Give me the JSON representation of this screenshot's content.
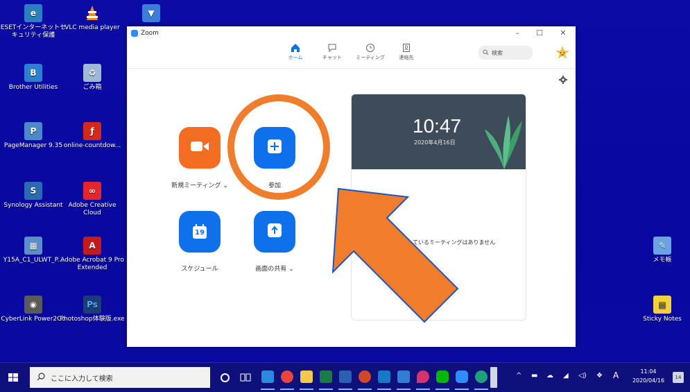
{
  "desktop": {
    "icons": [
      {
        "label": "ESETインターネットセキュリティ保護",
        "icon": "eset-icon",
        "color": "#2a7fbf"
      },
      {
        "label": "VLC media player",
        "icon": "vlc-cone-icon",
        "color": "#f08a24"
      },
      {
        "label": "",
        "icon": "installer-icon",
        "color": "#3b7dd8"
      },
      {
        "label": "Brother Utilities",
        "icon": "brother-icon",
        "color": "#2d7fd0"
      },
      {
        "label": "ごみ箱",
        "icon": "recycle-bin-icon",
        "color": "#9fb8d8"
      },
      {
        "label": "PageManager 9.35",
        "icon": "pagemanager-icon",
        "color": "#4a88c8"
      },
      {
        "label": "online-countdow...",
        "icon": "flash-icon",
        "color": "#d6271b"
      },
      {
        "label": "Synology Assistant",
        "icon": "synology-icon",
        "color": "#2a6bb0"
      },
      {
        "label": "Adobe Creative Cloud",
        "icon": "creative-cloud-icon",
        "color": "#e4262b"
      },
      {
        "label": "Y15A_C1_ULWT_P...",
        "icon": "document-icon",
        "color": "#5a8ec9"
      },
      {
        "label": "Adobe Acrobat 9 Pro Extended",
        "icon": "acrobat-icon",
        "color": "#c61a1a"
      },
      {
        "label": "CyberLink Power2Go",
        "icon": "power2go-icon",
        "color": "#5a5a5a"
      },
      {
        "label": "Photoshop体験版.exe",
        "icon": "photoshop-icon",
        "color": "#1c3c78"
      },
      {
        "label": "メモ帳",
        "icon": "notepad-icon",
        "color": "#6aa3e0"
      },
      {
        "label": "Sticky Notes",
        "icon": "sticky-notes-icon",
        "color": "#f4d13b"
      }
    ]
  },
  "zoom": {
    "title": "Zoom",
    "window_controls": {
      "minimize": "–",
      "maximize": "☐",
      "close": "✕"
    },
    "tabs": [
      {
        "label": "ホーム",
        "icon": "home-icon",
        "active": true
      },
      {
        "label": "チャット",
        "icon": "chat-icon",
        "active": false
      },
      {
        "label": "ミーティング",
        "icon": "clock-icon",
        "active": false
      },
      {
        "label": "連絡先",
        "icon": "contacts-icon",
        "active": false
      }
    ],
    "search": {
      "placeholder": "検索"
    },
    "actions": [
      {
        "label": "新規ミーティング ⌄",
        "icon": "video-camera-icon",
        "color": "#f26d21"
      },
      {
        "label": "参加",
        "icon": "plus-icon",
        "color": "#0e71eb"
      },
      {
        "label": "スケジュール",
        "icon": "calendar-icon",
        "color": "#0e71eb",
        "calendar_day": "19"
      },
      {
        "label": "画面の共有 ⌄",
        "icon": "share-arrow-icon",
        "color": "#0e71eb"
      }
    ],
    "clock": {
      "time": "10:47",
      "date": "2020年4月16日",
      "empty_message": "ているミーティングはありません"
    }
  },
  "annotation": {
    "color": "#f07d2b",
    "outline": "#1a55c8"
  },
  "taskbar": {
    "search_placeholder": "ここに入力して検索",
    "apps": [
      {
        "icon": "cortana-icon"
      },
      {
        "icon": "task-view-icon"
      },
      {
        "icon": "edge-icon",
        "color": "#2b8ae0"
      },
      {
        "icon": "chrome-icon",
        "color": "#e8453c"
      },
      {
        "icon": "file-explorer-icon",
        "color": "#f2c94c"
      },
      {
        "icon": "excel-icon",
        "color": "#1d7a45"
      },
      {
        "icon": "word-icon",
        "color": "#2b5fb3"
      },
      {
        "icon": "powerpoint-icon",
        "color": "#d24726"
      },
      {
        "icon": "outlook-icon",
        "color": "#1479c9"
      },
      {
        "icon": "photos-icon",
        "color": "#2f7fd6"
      },
      {
        "icon": "maps-icon",
        "color": "#d6336c"
      },
      {
        "icon": "line-icon",
        "color": "#00b900"
      },
      {
        "icon": "zoom-taskbar-icon",
        "color": "#2d8cff"
      },
      {
        "icon": "edge-dev-icon",
        "color": "#1f9f7a"
      }
    ],
    "tray": {
      "ime": "A",
      "time": "11:04",
      "date": "2020/04/16",
      "notifications": "14"
    }
  }
}
